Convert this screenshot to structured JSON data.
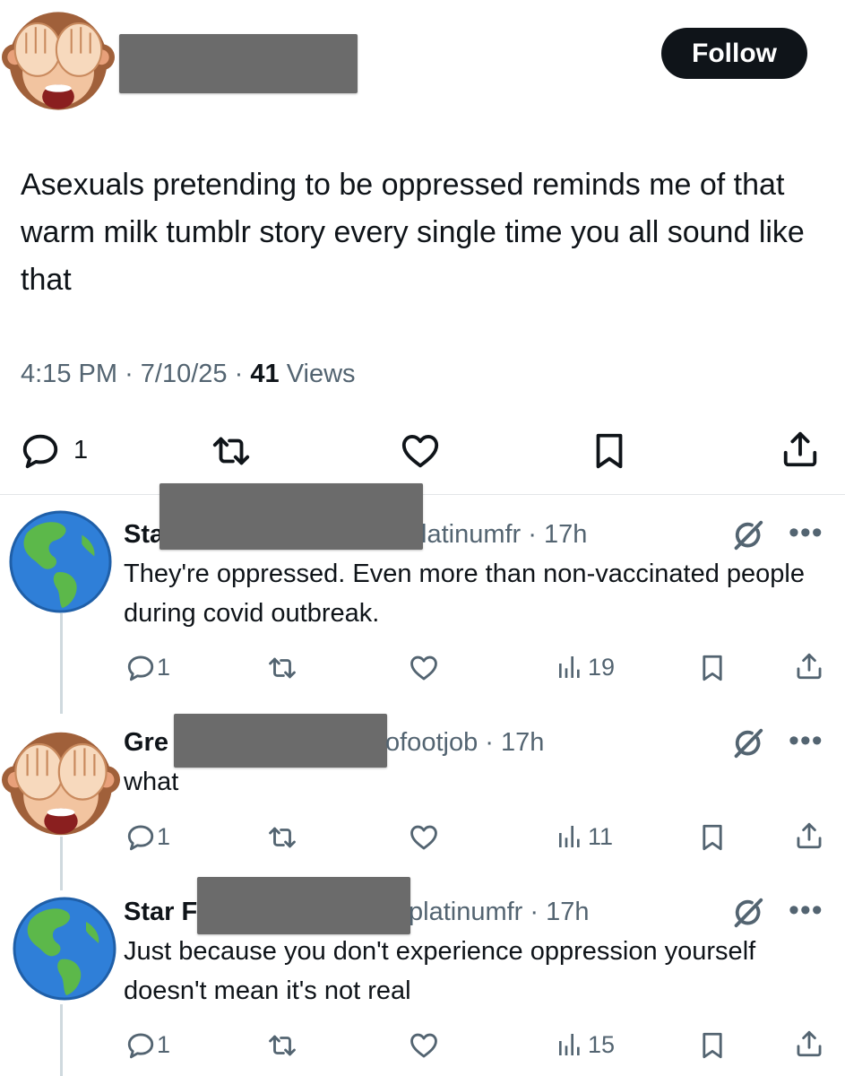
{
  "post": {
    "follow_label": "Follow",
    "text": "Asexuals pretending to be oppressed reminds me of that warm milk tumblr story every single time you all sound like that",
    "time": "4:15 PM",
    "date": "7/10/25",
    "views_count": "41",
    "views_label": "Views",
    "reply_count": "1"
  },
  "replies": [
    {
      "name": "Sta",
      "handle": "latinumfr",
      "time": "17h",
      "text": "They're oppressed. Even more than non-vaccinated people during covid outbreak.",
      "reply_count": "1",
      "views": "19"
    },
    {
      "name": "Gre",
      "handle": "ofootjob",
      "time": "17h",
      "text": "what",
      "reply_count": "1",
      "views": "11"
    },
    {
      "name": "Star F",
      "handle": "platinumfr",
      "time": "17h",
      "text": "Just because you don't experience oppression yourself doesn't mean it's not real",
      "reply_count": "1",
      "views": "15"
    }
  ],
  "separator": "·",
  "avatars": [
    "monkey-covering-eyes-icon",
    "globe-americas-icon"
  ],
  "colors": {
    "text": "#0f1419",
    "secondary": "#536471",
    "follow_bg": "#0f1419",
    "redaction": "#6b6b6b"
  }
}
